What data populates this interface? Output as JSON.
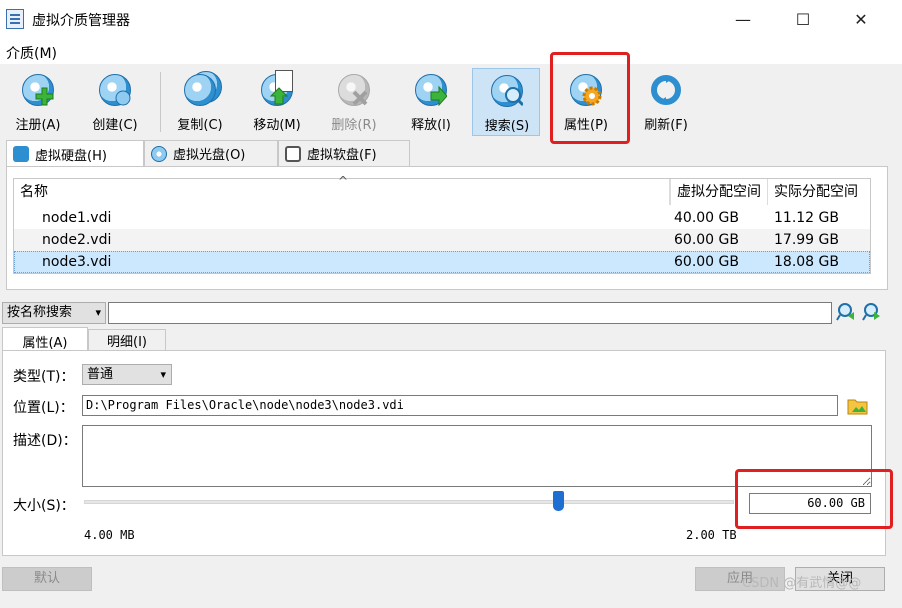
{
  "window": {
    "title": "虚拟介质管理器",
    "minimize_glyph": "—",
    "maximize_glyph": "☐",
    "close_glyph": "✕"
  },
  "menu": {
    "media_label": "介质(M)"
  },
  "toolbar": {
    "items": [
      {
        "label": "注册(A)",
        "icon": "register-disk-icon",
        "enabled": true
      },
      {
        "label": "创建(C)",
        "icon": "create-disk-icon",
        "enabled": true
      },
      {
        "label": "复制(C)",
        "icon": "copy-disk-icon",
        "enabled": true
      },
      {
        "label": "移动(M)",
        "icon": "move-disk-icon",
        "enabled": true
      },
      {
        "label": "删除(R)",
        "icon": "remove-disk-icon",
        "enabled": false
      },
      {
        "label": "释放(l)",
        "icon": "release-disk-icon",
        "enabled": true
      },
      {
        "label": "搜索(S)",
        "icon": "search-disk-icon",
        "enabled": true,
        "active": true
      },
      {
        "label": "属性(P)",
        "icon": "properties-gear-icon",
        "enabled": true,
        "highlighted": true
      },
      {
        "label": "刷新(F)",
        "icon": "refresh-icon",
        "enabled": true
      }
    ]
  },
  "media_tabs": [
    {
      "label": "虚拟硬盘(H)",
      "selected": true
    },
    {
      "label": "虚拟光盘(O)",
      "selected": false
    },
    {
      "label": "虚拟软盘(F)",
      "selected": false
    }
  ],
  "table": {
    "sort_indicator": "^",
    "columns": [
      "名称",
      "虚拟分配空间",
      "实际分配空间"
    ],
    "rows": [
      {
        "name": "node1.vdi",
        "virtual": "40.00 GB",
        "actual": "11.12 GB",
        "selected": false
      },
      {
        "name": "node2.vdi",
        "virtual": "60.00 GB",
        "actual": "17.99 GB",
        "selected": false
      },
      {
        "name": "node3.vdi",
        "virtual": "60.00 GB",
        "actual": "18.08 GB",
        "selected": true
      }
    ]
  },
  "search": {
    "mode": "按名称搜索",
    "value": "",
    "dropdown_glyph": "▾"
  },
  "detail_tabs": [
    {
      "label": "属性(A)",
      "selected": true
    },
    {
      "label": "明细(I)",
      "selected": false
    }
  ],
  "properties": {
    "type_label": "类型(T)：",
    "type_value": "普通",
    "location_label": "位置(L)：",
    "location_value": "D:\\Program Files\\Oracle\\node\\node3\\node3.vdi",
    "description_label": "描述(D)：",
    "description_value": "",
    "size_label": "大小(S)：",
    "size_value": "60.00 GB",
    "size_min": "4.00 MB",
    "size_max": "2.00 TB",
    "slider_fraction": 0.73
  },
  "buttons": {
    "reset": "默认",
    "apply": "应用",
    "close": "关闭"
  },
  "watermark": "CSDN @有武情@@",
  "colors": {
    "selection": "#cce8ff",
    "highlight_box": "#e02020",
    "slider_thumb": "#1e6fd1"
  }
}
